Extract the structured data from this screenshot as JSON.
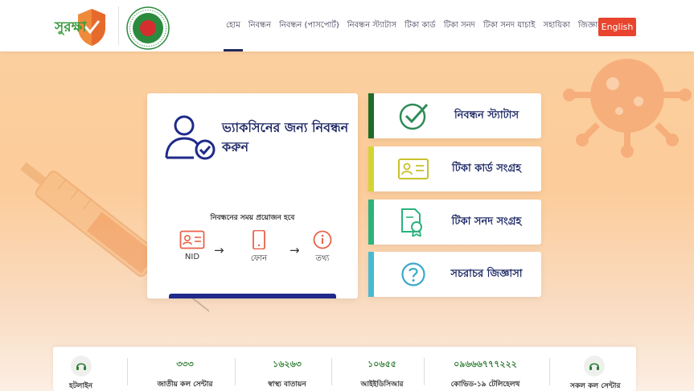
{
  "header": {
    "logo_text": "সুরক্ষা",
    "nav": [
      {
        "label": "হোম",
        "active": true
      },
      {
        "label": "নিবন্ধন"
      },
      {
        "label": "নিবন্ধন (পাসপোর্ট)"
      },
      {
        "label": "নিবন্ধন স্ট্যাটাস"
      },
      {
        "label": "টিকা কার্ড"
      },
      {
        "label": "টিকা সনদ"
      },
      {
        "label": "টিকা সনদ যাচাই"
      },
      {
        "label": "সহায়িকা"
      },
      {
        "label": "জিজ্ঞাসা"
      }
    ],
    "lang_button": "English"
  },
  "main_card": {
    "title": "ভ্যাকসিনের জন্য নিবন্ধন করুন",
    "requirements_label": "নিবন্ধনের সময় প্রয়োজন হবে",
    "steps": [
      "NID",
      "ফোন",
      "তথ্য"
    ]
  },
  "side_cards": [
    {
      "label": "নিবন্ধন স্ট্যাটাস",
      "icon": "check-circle-icon",
      "accent": "#1e6b2a"
    },
    {
      "label": "টিকা কার্ড সংগ্রহ",
      "icon": "id-card-icon",
      "accent": "#d3d433"
    },
    {
      "label": "টিকা সনদ সংগ্রহ",
      "icon": "certificate-icon",
      "accent": "#2bb37e"
    },
    {
      "label": "সচরাচর জিজ্ঞাসা",
      "icon": "question-circle-icon",
      "accent": "#49b9d1"
    }
  ],
  "footer": {
    "hotline_left": "হটলাইন",
    "hotline_right": "সকল কল সেন্টার",
    "numbers": [
      {
        "number": "৩৩৩",
        "name": "জাতীয় কল সেন্টার"
      },
      {
        "number": "১৬২৬৩",
        "name": "স্বাস্থ্য বাতায়ন"
      },
      {
        "number": "১০৬৫৫",
        "name": "আইইডিসিআর"
      },
      {
        "number": "০৯৬৬৬৭৭৭২২২",
        "name": "কোভিড-১৯ টেলিহেলথ"
      }
    ]
  },
  "colors": {
    "accent": "#e8442e",
    "navy": "#1f2a66",
    "icon_orange": "#e8634a",
    "icon_green": "#2e8b57"
  }
}
